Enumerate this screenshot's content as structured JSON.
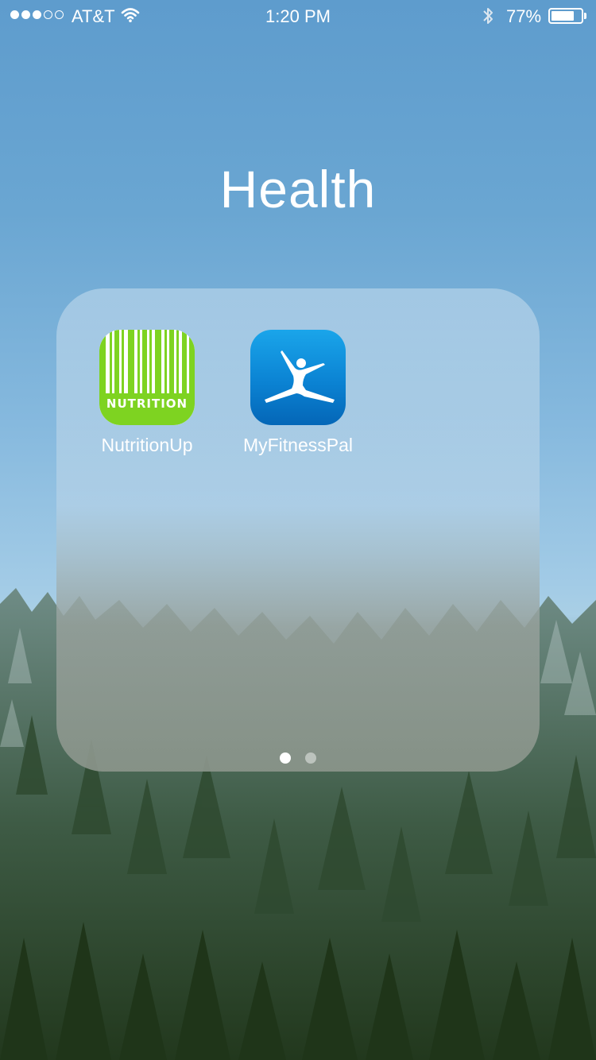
{
  "status_bar": {
    "carrier": "AT&T",
    "time": "1:20 PM",
    "battery_percent": "77%",
    "battery_level": 0.77,
    "signal_bars_filled": 3,
    "signal_bars_total": 5,
    "icons": [
      "wifi-icon",
      "bluetooth-icon",
      "battery-icon"
    ]
  },
  "folder": {
    "title": "Health",
    "apps": [
      {
        "name": "NutritionUp",
        "icon": "nutritionup-barcode-icon",
        "icon_text": "NUTRITION",
        "accent": "#7ed321"
      },
      {
        "name": "MyFitnessPal",
        "icon": "myfitnesspal-figure-icon",
        "accent": "#0a7fd0"
      }
    ],
    "pages": {
      "count": 2,
      "current": 1
    }
  }
}
